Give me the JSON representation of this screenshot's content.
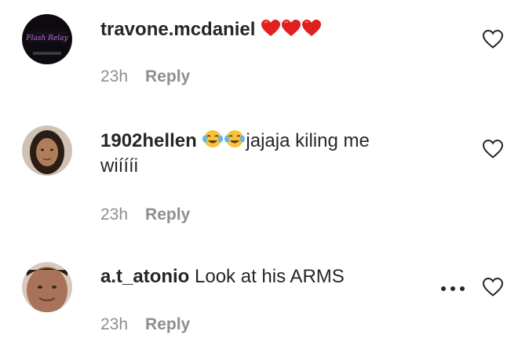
{
  "comments": [
    {
      "username": "travone.mcdaniel",
      "text": "",
      "emoji": [
        "red-heart",
        "red-heart",
        "red-heart"
      ],
      "time": "23h",
      "reply_label": "Reply",
      "avatar_text": "Flash Relay"
    },
    {
      "username": "1902hellen",
      "text_after_emoji": "jajaja kiling me",
      "text_line2": "wiíííi",
      "emoji": [
        "tears-of-joy",
        "tears-of-joy"
      ],
      "time": "23h",
      "reply_label": "Reply"
    },
    {
      "username": "a.t_atonio",
      "text": "Look at his ARMS",
      "time": "23h",
      "reply_label": "Reply"
    }
  ],
  "colors": {
    "text": "#262626",
    "meta": "#8e8e8e",
    "heart_emoji": "#e0201f",
    "joy_emoji": "#f7c23a"
  }
}
